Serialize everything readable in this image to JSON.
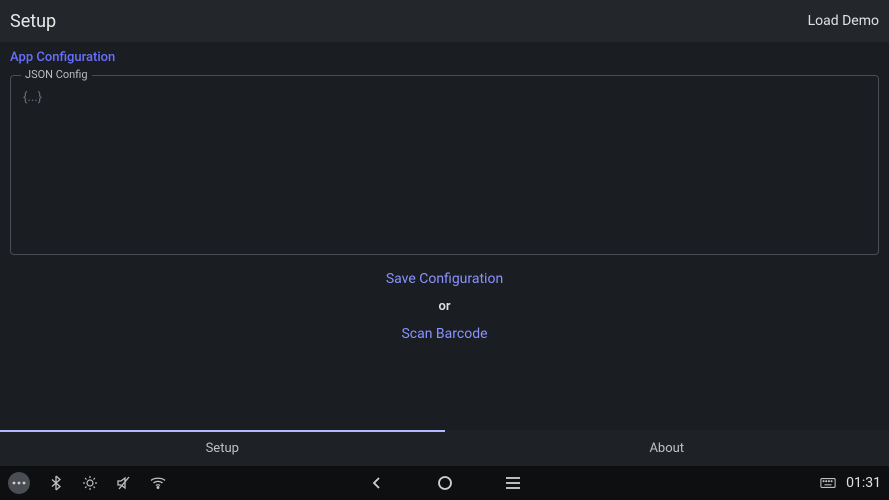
{
  "header": {
    "title": "Setup",
    "action": "Load Demo"
  },
  "config": {
    "section_title": "App Configuration",
    "field_label": "JSON Config",
    "placeholder": "{...}"
  },
  "actions": {
    "save": "Save Configuration",
    "or": "or",
    "scan": "Scan Barcode"
  },
  "tabs": {
    "setup": "Setup",
    "about": "About"
  },
  "statusbar": {
    "time": "01:31"
  }
}
